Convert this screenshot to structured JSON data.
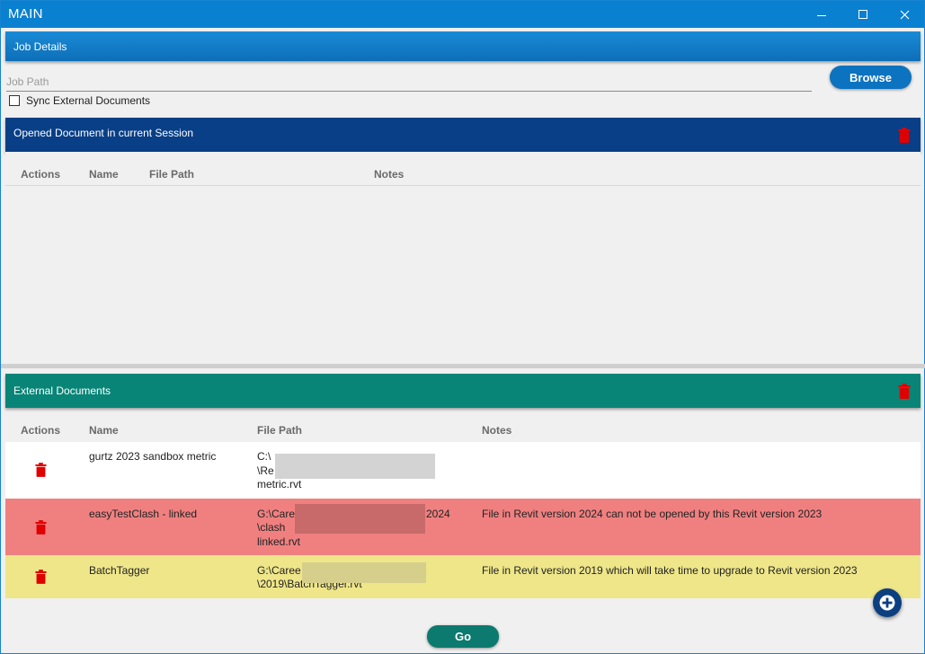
{
  "window": {
    "title": "MAIN"
  },
  "job_details": {
    "header": "Job Details",
    "job_path_placeholder": "Job Path",
    "job_path_value": "",
    "browse_label": "Browse",
    "sync_label": "Sync External Documents",
    "sync_checked": false
  },
  "opened_documents": {
    "header": "Opened Document in current Session",
    "columns": [
      "Actions",
      "Name",
      "File Path",
      "Notes"
    ],
    "rows": []
  },
  "external_documents": {
    "header": "External Documents",
    "columns": [
      "Actions",
      "Name",
      "File Path",
      "Notes"
    ],
    "rows": [
      {
        "name": "gurtz 2023 sandbox metric",
        "path_lines": [
          "C:\\",
          "\\Re",
          "metric.rvt"
        ],
        "notes": "",
        "status_color": "#ffffff"
      },
      {
        "name": "easyTestClash - linked",
        "path_lines": [
          "G:\\Care",
          "\\clash",
          "linked.rvt"
        ],
        "path_suffix": "2024",
        "notes": "File in Revit version 2024 can not be opened by this Revit version 2023",
        "status_color": "#f08080"
      },
      {
        "name": "BatchTagger",
        "path_lines": [
          "G:\\Caree",
          "\\2019\\BatchTagger.rvt"
        ],
        "notes": "File in Revit version 2019 which will take time to upgrade to Revit version 2023",
        "status_color": "#eee689"
      }
    ]
  },
  "actions": {
    "go_label": "Go"
  },
  "colors": {
    "title_bar": "#0a80d0",
    "job_header": "#0d6fb8",
    "opened_header": "#083f86",
    "external_header": "#088577",
    "trash": "#e00000"
  }
}
